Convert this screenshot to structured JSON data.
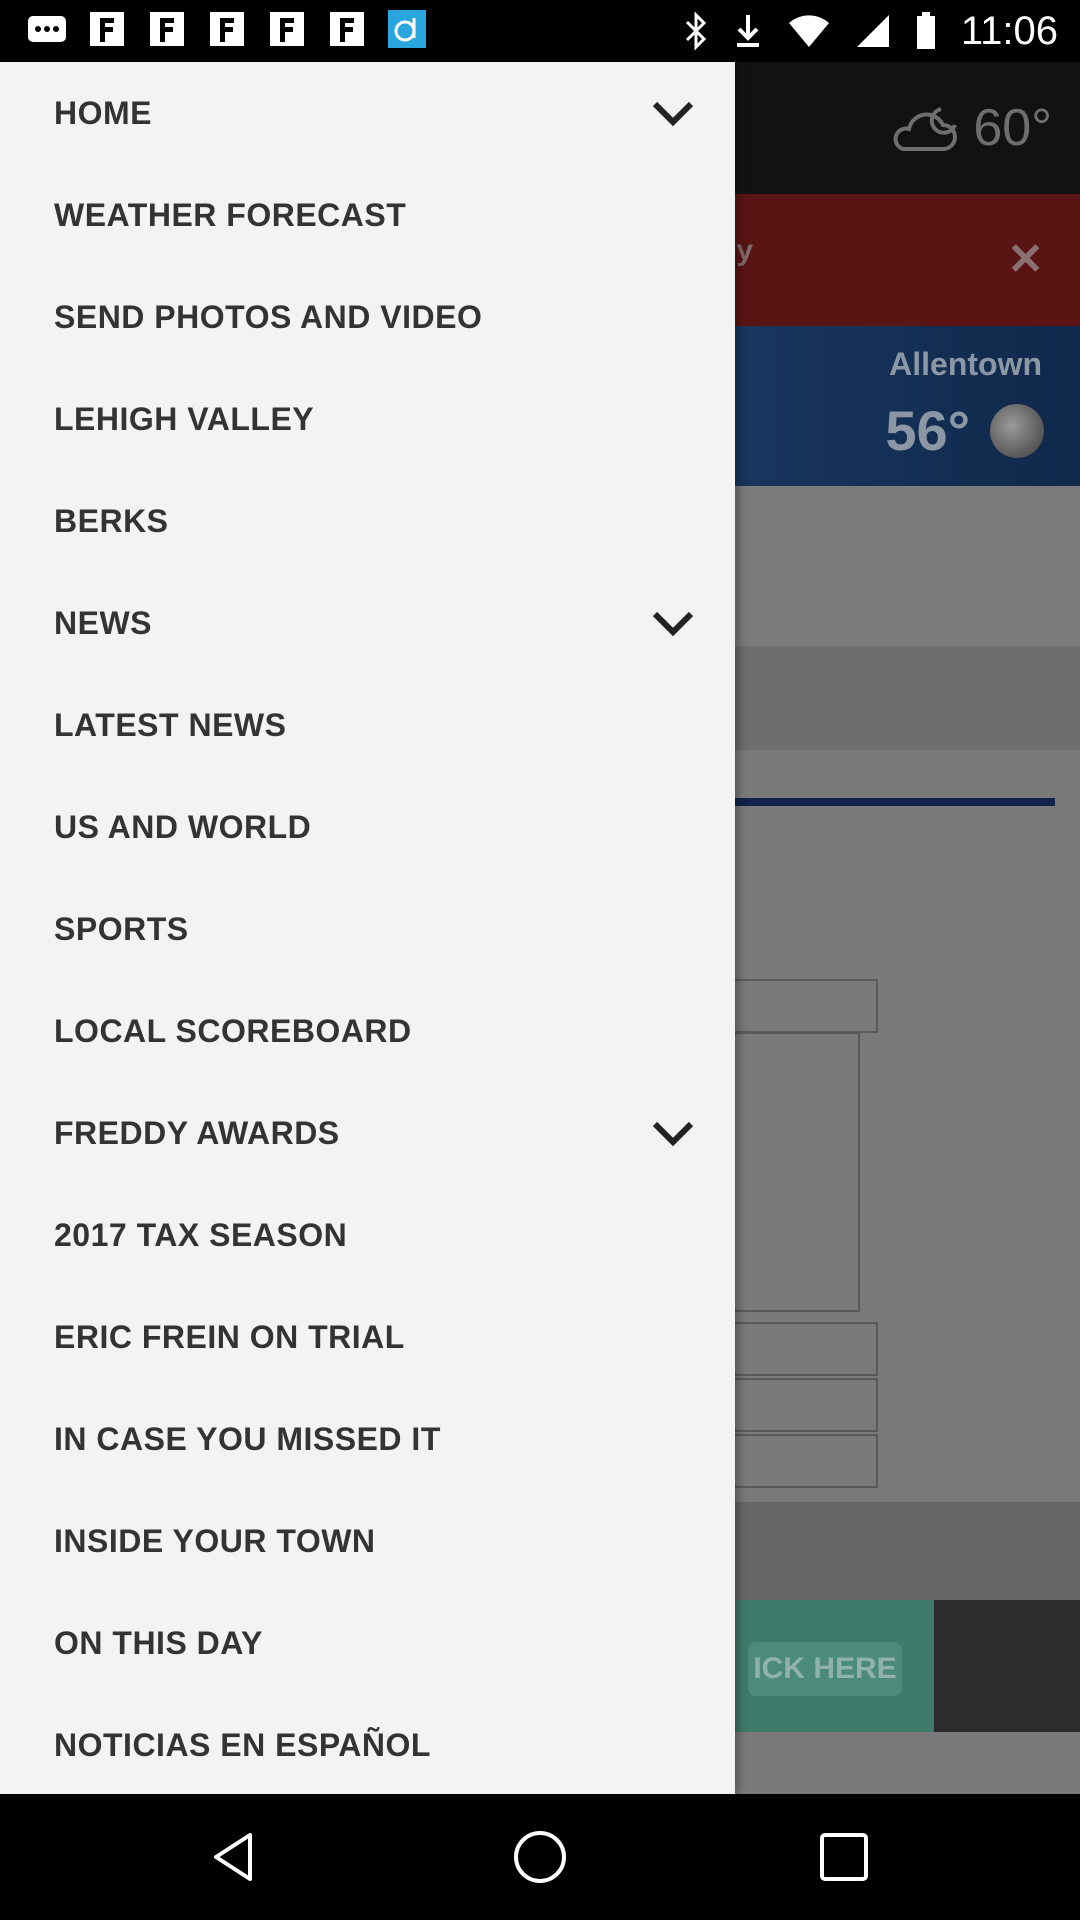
{
  "status_bar": {
    "time": "11:06",
    "left_icons": [
      "messages-icon",
      "app-f-icon",
      "app-f-icon",
      "app-f-icon",
      "app-f-icon",
      "app-f-icon",
      "app-d-icon"
    ],
    "right_icons": [
      "bluetooth-icon",
      "download-icon",
      "wifi-icon",
      "signal-icon",
      "battery-icon"
    ]
  },
  "background": {
    "weather_temp": "60°",
    "banner_text": "oy",
    "card_city": "Allentown",
    "card_temp": "56°",
    "ad_text": "ICK HERE"
  },
  "drawer": {
    "items": [
      {
        "label": "HOME",
        "expandable": true
      },
      {
        "label": "WEATHER FORECAST",
        "expandable": false
      },
      {
        "label": "SEND PHOTOS AND VIDEO",
        "expandable": false
      },
      {
        "label": "LEHIGH VALLEY",
        "expandable": false
      },
      {
        "label": "BERKS",
        "expandable": false
      },
      {
        "label": "NEWS",
        "expandable": true
      },
      {
        "label": "LATEST NEWS",
        "expandable": false
      },
      {
        "label": "US AND WORLD",
        "expandable": false
      },
      {
        "label": "SPORTS",
        "expandable": false
      },
      {
        "label": "LOCAL SCOREBOARD",
        "expandable": false
      },
      {
        "label": "FREDDY AWARDS",
        "expandable": true
      },
      {
        "label": "2017 TAX SEASON",
        "expandable": false
      },
      {
        "label": "ERIC FREIN ON TRIAL",
        "expandable": false
      },
      {
        "label": "IN CASE YOU MISSED IT",
        "expandable": false
      },
      {
        "label": "INSIDE YOUR TOWN",
        "expandable": false
      },
      {
        "label": "ON THIS DAY",
        "expandable": false
      },
      {
        "label": "NOTICIAS EN ESPAÑOL",
        "expandable": false
      }
    ]
  },
  "nav_bar": {
    "buttons": [
      "back-icon",
      "home-icon",
      "recents-icon"
    ]
  },
  "colors": {
    "drawer_bg": "#f3f3f3",
    "item_text": "#333333",
    "scrim": "#7a7a7a"
  }
}
